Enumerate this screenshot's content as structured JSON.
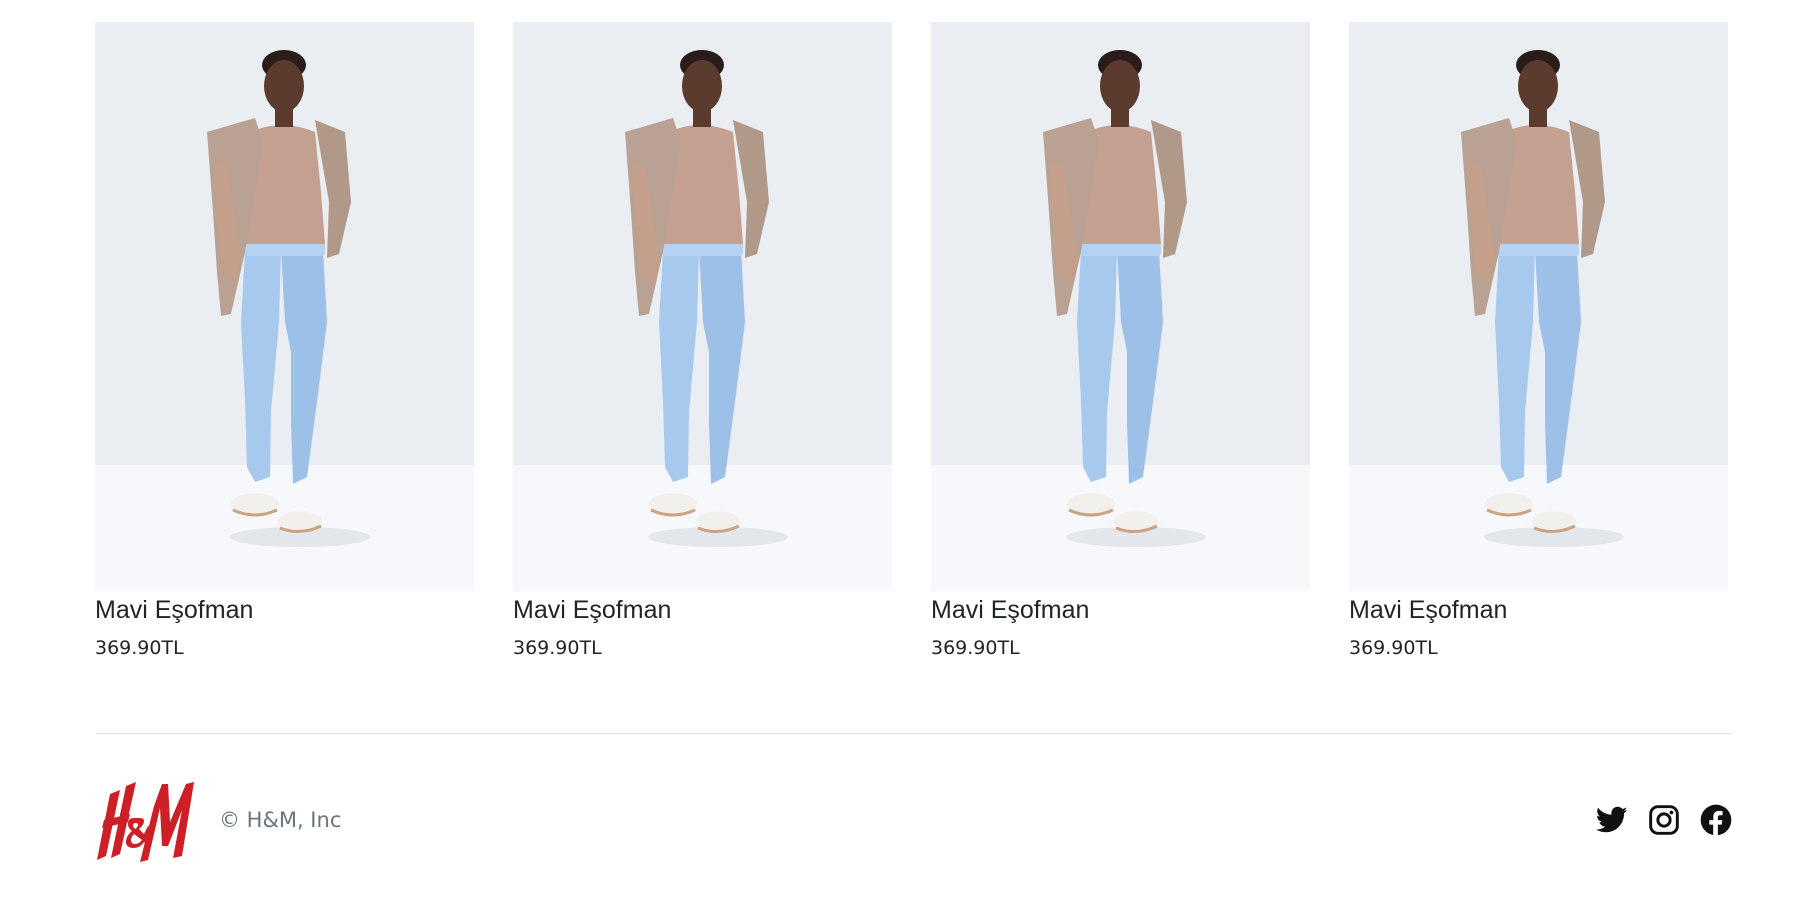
{
  "products": [
    {
      "name": "Mavi Eşofman",
      "price": "369.90TL"
    },
    {
      "name": "Mavi Eşofman",
      "price": "369.90TL"
    },
    {
      "name": "Mavi Eşofman",
      "price": "369.90TL"
    },
    {
      "name": "Mavi Eşofman",
      "price": "369.90TL"
    }
  ],
  "footer": {
    "brand": "H&M",
    "copyright": "© H&M, Inc",
    "social_icons": [
      "twitter-icon",
      "instagram-icon",
      "facebook-icon"
    ]
  },
  "colors": {
    "brand_red": "#cc1f26",
    "text": "#212529",
    "muted": "#6c757d",
    "divider": "#e1e4e8"
  }
}
